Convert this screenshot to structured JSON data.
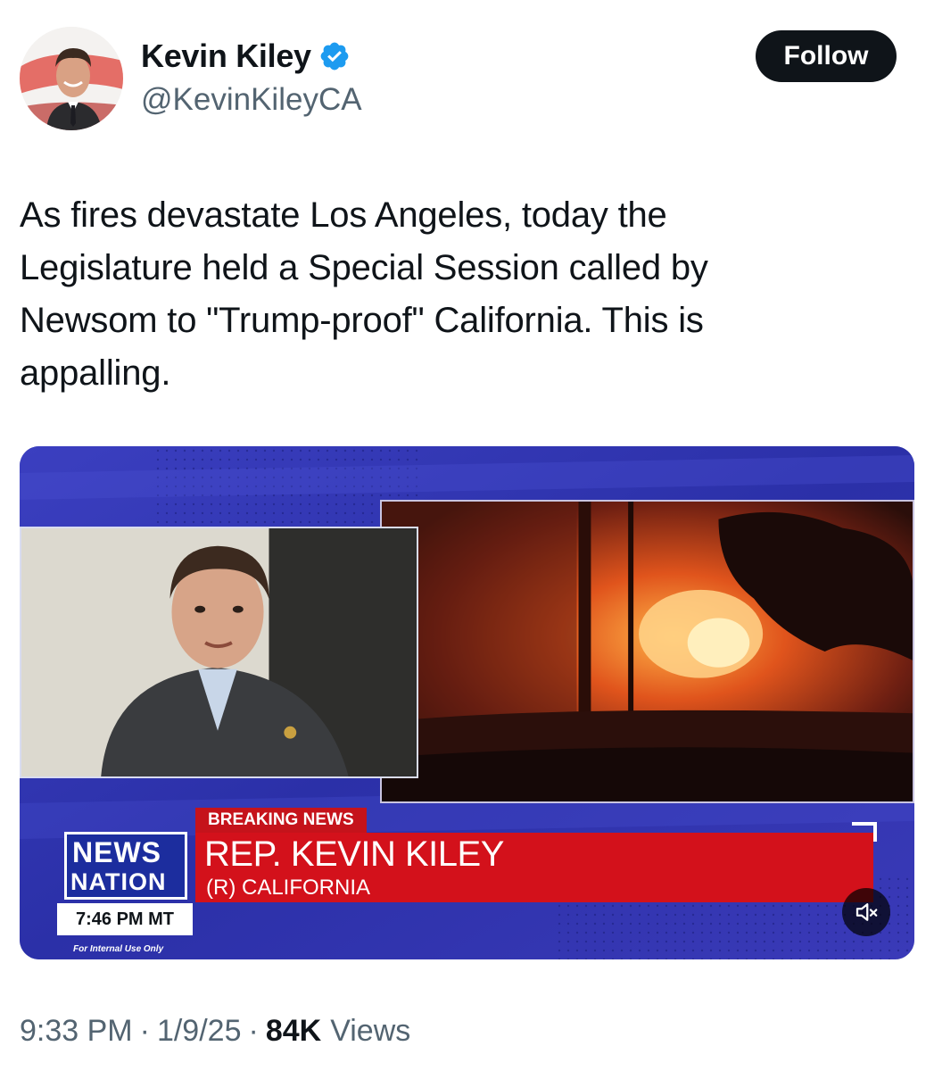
{
  "author": {
    "display_name": "Kevin Kiley",
    "handle": "@KevinKileyCA",
    "verified": true,
    "verified_color": "#1d9bf0"
  },
  "follow_button": {
    "label": "Follow"
  },
  "tweet": {
    "text": "As fires devastate Los Angeles, today the\nLegislature held a Special Session called by\nNewsom to \"Trump-proof\" California. This is\nappalling."
  },
  "media": {
    "breaking_label": "BREAKING NEWS",
    "headline_name": "REP. KEVIN KILEY",
    "headline_sub": "(R) CALIFORNIA",
    "network_line1": "NEWS",
    "network_line2": "NATION",
    "clock": "7:46 PM MT",
    "internal_note": "For Internal Use Only",
    "mute_icon": "speaker-muted-icon"
  },
  "meta": {
    "time": "9:33 PM",
    "separator": "·",
    "date": "1/9/25",
    "views_count": "84K",
    "views_label": "Views"
  },
  "colors": {
    "text_primary": "#0f1419",
    "text_secondary": "#536471",
    "lower_third_red": "#d3111b",
    "broadcast_blue": "#2a33a6"
  }
}
